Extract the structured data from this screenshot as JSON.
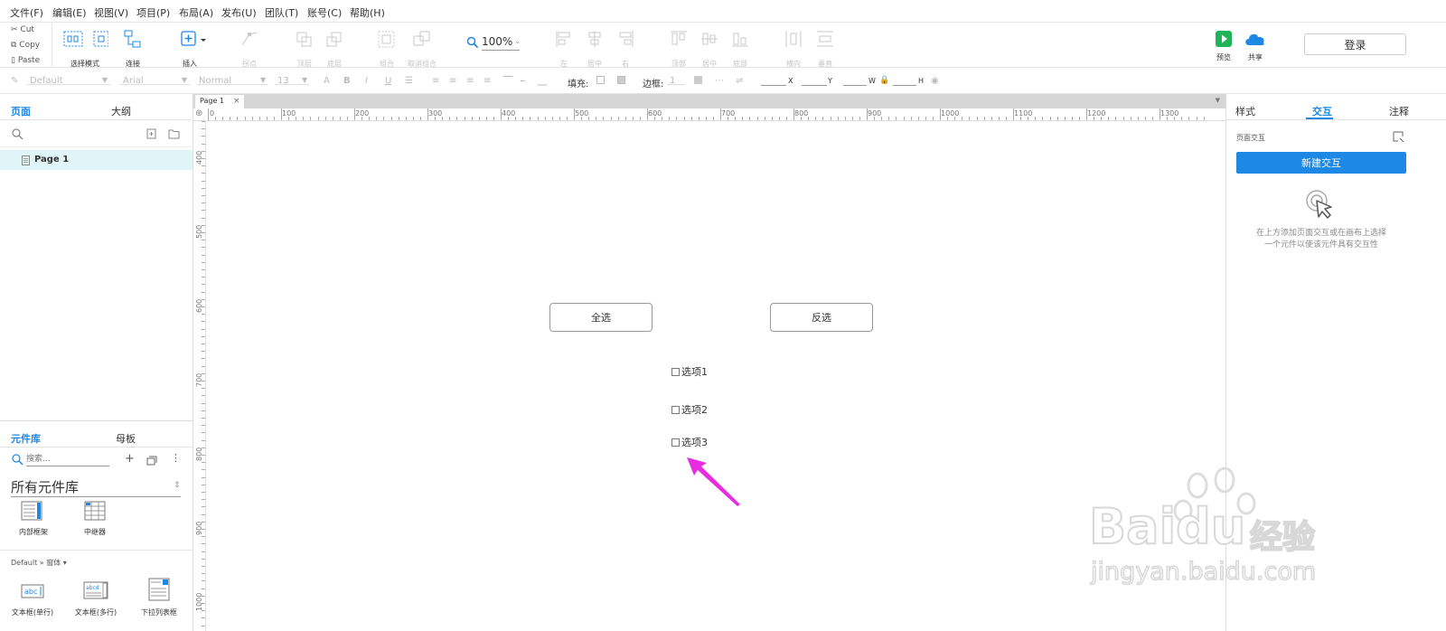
{
  "menu": [
    "文件(F)",
    "编辑(E)",
    "视图(V)",
    "项目(P)",
    "布局(A)",
    "发布(U)",
    "团队(T)",
    "账号(C)",
    "帮助(H)"
  ],
  "clipboard": {
    "cut": "Cut",
    "copy": "Copy",
    "paste": "Paste"
  },
  "toolbar": {
    "select_mode": "选择模式",
    "connect": "连接",
    "insert": "插入",
    "point": "拐点",
    "top_layer": "顶层",
    "bottom_layer": "底层",
    "group": "组合",
    "ungroup": "取消组合",
    "zoom": "100%",
    "left": "左",
    "center": "居中",
    "right": "右",
    "top": "顶部",
    "middle": "居中",
    "bottom": "底部",
    "horizontal": "横向",
    "vertical": "垂直",
    "preview": "预览",
    "share": "共享",
    "login": "登录"
  },
  "format": {
    "style": "Default",
    "font": "Arial",
    "weight": "Normal",
    "size": "13",
    "fill_label": "填充:",
    "border_label": "边框:",
    "border_value": "1",
    "x_label": "X",
    "y_label": "Y",
    "w_label": "W",
    "h_label": "H"
  },
  "left": {
    "tab_pages": "页面",
    "tab_outline": "大纲",
    "page_item": "Page 1",
    "tab_library": "元件库",
    "tab_masters": "母板",
    "search_placeholder": "搜索...",
    "library_name": "所有元件库",
    "widgets_top": [
      "内部框架",
      "中继器"
    ],
    "section": "Default » 窗体 ▾",
    "widgets_bottom": [
      "文本框(单行)",
      "文本框(多行)",
      "下拉列表框"
    ]
  },
  "canvas": {
    "page_tab": "Page 1",
    "hruler": [
      "0",
      "100",
      "200",
      "300",
      "400",
      "500",
      "600",
      "700",
      "800",
      "900",
      "1000",
      "1100",
      "1200",
      "1300"
    ],
    "vruler": [
      "400",
      "500",
      "600",
      "700",
      "800",
      "900",
      "1000"
    ],
    "btn_select_all": "全选",
    "btn_invert": "反选",
    "options": [
      "选项1",
      "选项2",
      "选项3"
    ]
  },
  "right": {
    "tab_style": "样式",
    "tab_interaction": "交互",
    "tab_notes": "注释",
    "page_interaction": "页面交互",
    "new_interaction": "新建交互",
    "hint": "在上方添加页面交互或在画布上选择一个元件以使该元件具有交互性"
  },
  "watermark": {
    "brand": "Baidu",
    "cn": "经验",
    "url": "jingyan.baidu.com"
  },
  "colors": {
    "accent": "#1e88e5",
    "arrow": "#e62ee0"
  }
}
